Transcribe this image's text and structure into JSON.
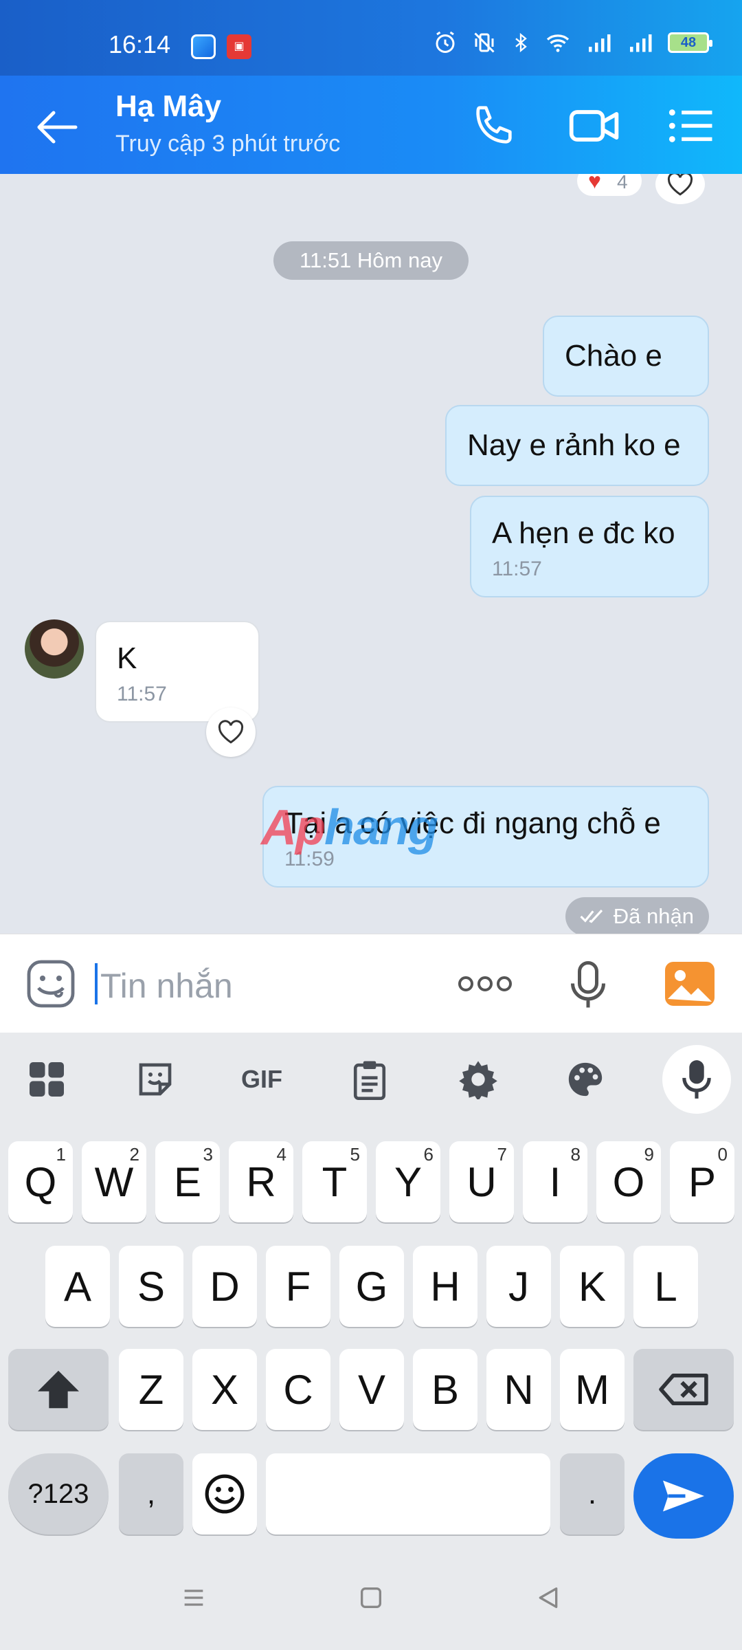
{
  "status_bar": {
    "time": "16:14",
    "battery": "48"
  },
  "header": {
    "contact_name": "Hạ Mây",
    "contact_status": "Truy cập 3 phút trước"
  },
  "chat": {
    "top_reaction_count": "4",
    "date_divider": "11:51 Hôm nay",
    "messages": [
      {
        "direction": "out",
        "text": "Chào e",
        "time": ""
      },
      {
        "direction": "out",
        "text": "Nay e rảnh ko e",
        "time": ""
      },
      {
        "direction": "out",
        "text": "A hẹn e đc ko",
        "time": "11:57"
      },
      {
        "direction": "in",
        "text": "K",
        "time": "11:57"
      },
      {
        "direction": "out",
        "text": "Tại a có việc đi ngang chỗ e",
        "time": "11:59"
      }
    ],
    "delivery_status": "Đã nhận",
    "watermark": "Aphang"
  },
  "composer": {
    "placeholder": "Tin nhắn"
  },
  "keyboard": {
    "toolbar": [
      "apps-icon",
      "sticker-icon",
      "GIF",
      "clipboard-icon",
      "settings-icon",
      "palette-icon",
      "mic-icon"
    ],
    "row1": [
      {
        "k": "Q",
        "h": "1"
      },
      {
        "k": "W",
        "h": "2"
      },
      {
        "k": "E",
        "h": "3"
      },
      {
        "k": "R",
        "h": "4"
      },
      {
        "k": "T",
        "h": "5"
      },
      {
        "k": "Y",
        "h": "6"
      },
      {
        "k": "U",
        "h": "7"
      },
      {
        "k": "I",
        "h": "8"
      },
      {
        "k": "O",
        "h": "9"
      },
      {
        "k": "P",
        "h": "0"
      }
    ],
    "row2": [
      "A",
      "S",
      "D",
      "F",
      "G",
      "H",
      "J",
      "K",
      "L"
    ],
    "row3": [
      "Z",
      "X",
      "C",
      "V",
      "B",
      "N",
      "M"
    ],
    "symbols_label": "?123",
    "comma": ",",
    "period": "."
  },
  "colors": {
    "header_blue": "#1f74f0",
    "bubble_out": "#d5edfd",
    "send_blue": "#1a73e8"
  }
}
